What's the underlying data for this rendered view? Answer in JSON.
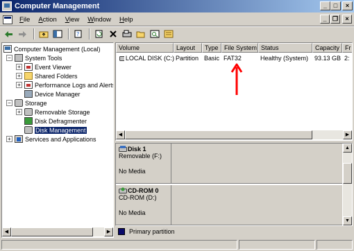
{
  "window": {
    "title": "Computer Management"
  },
  "title_buttons": {
    "minimize": "_",
    "maximize": "□",
    "close": "×"
  },
  "menu": {
    "items": [
      "File",
      "Action",
      "View",
      "Window",
      "Help"
    ]
  },
  "mdi_buttons": {
    "minimize": "_",
    "restore": "❐",
    "close": "×"
  },
  "toolbar": {
    "icons": [
      "back-arrow-icon",
      "forward-arrow-icon",
      "up-folder-icon",
      "show-tree-icon",
      "properties-icon",
      "refresh-icon",
      "delete-icon",
      "disk-properties-icon",
      "open-folder-icon",
      "search-icon",
      "help-icon"
    ]
  },
  "tree": {
    "root": "Computer Management (Local)",
    "system_tools": "System Tools",
    "event_viewer": "Event Viewer",
    "shared_folders": "Shared Folders",
    "perf_logs": "Performance Logs and Alerts",
    "device_manager": "Device Manager",
    "storage": "Storage",
    "removable_storage": "Removable Storage",
    "disk_defrag": "Disk Defragmenter",
    "disk_mgmt": "Disk Management",
    "services_apps": "Services and Applications"
  },
  "volumes": {
    "columns": [
      "Volume",
      "Layout",
      "Type",
      "File System",
      "Status",
      "Capacity",
      "Fr"
    ],
    "rows": [
      {
        "volume": "LOCAL DISK (C:)",
        "layout": "Partition",
        "type": "Basic",
        "fs": "FAT32",
        "status": "Healthy (System)",
        "capacity": "93.13 GB",
        "free": "2:"
      }
    ],
    "annotation_color": "#ff0000"
  },
  "disks": [
    {
      "name": "Disk 1",
      "type": "Removable (F:)",
      "media": "No Media"
    },
    {
      "name": "CD-ROM 0",
      "type": "CD-ROM (D:)",
      "media": "No Media"
    }
  ],
  "legend": {
    "label": "Primary partition",
    "color": "#0a0a6a"
  },
  "colors": {
    "selection": "#0a246a",
    "face": "#d4d0c8"
  }
}
